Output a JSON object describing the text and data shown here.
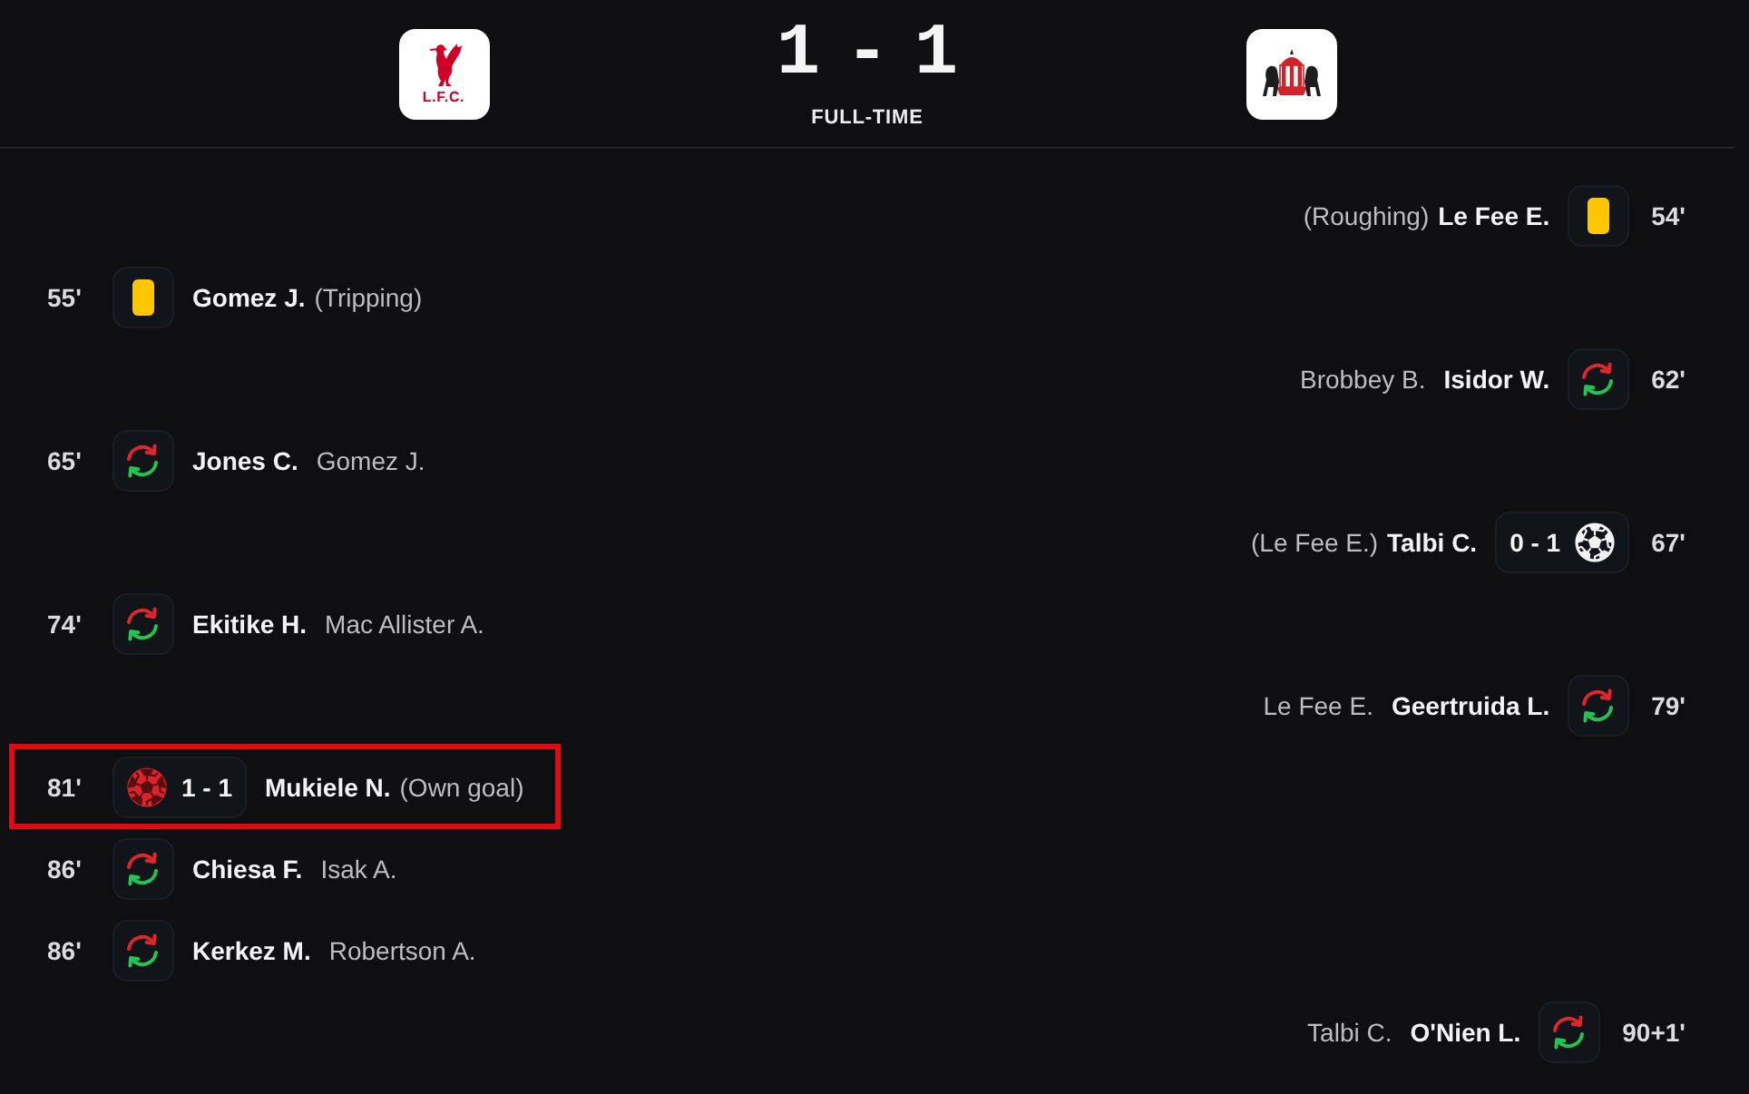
{
  "header": {
    "home_crest_text": "L.F.C.",
    "score": "1 - 1",
    "status": "FULL-TIME"
  },
  "events": [
    {
      "away": true,
      "minute": "54'",
      "kind": "yellow_card",
      "player": "Le Fee E.",
      "detail": "(Roughing)",
      "highlighted": false
    },
    {
      "away": false,
      "minute": "55'",
      "kind": "yellow_card",
      "player": "Gomez J.",
      "detail": "(Tripping)",
      "highlighted": false
    },
    {
      "away": true,
      "minute": "62'",
      "kind": "substitution",
      "player": "Isidor W.",
      "detail": "Brobbey B.",
      "highlighted": false
    },
    {
      "away": false,
      "minute": "65'",
      "kind": "substitution",
      "player": "Jones C.",
      "detail": "Gomez J.",
      "highlighted": false
    },
    {
      "away": true,
      "minute": "67'",
      "kind": "goal",
      "score": "0 - 1",
      "player": "Talbi C.",
      "detail": "(Le Fee E.)",
      "highlighted": false
    },
    {
      "away": false,
      "minute": "74'",
      "kind": "substitution",
      "player": "Ekitike H.",
      "detail": "Mac Allister A.",
      "highlighted": false
    },
    {
      "away": true,
      "minute": "79'",
      "kind": "substitution",
      "player": "Geertruida L.",
      "detail": "Le Fee E.",
      "highlighted": false
    },
    {
      "away": false,
      "minute": "81'",
      "kind": "own_goal",
      "score": "1 - 1",
      "player": "Mukiele N.",
      "detail": "(Own goal)",
      "highlighted": true
    },
    {
      "away": false,
      "minute": "86'",
      "kind": "substitution",
      "player": "Chiesa F.",
      "detail": "Isak A.",
      "highlighted": false
    },
    {
      "away": false,
      "minute": "86'",
      "kind": "substitution",
      "player": "Kerkez M.",
      "detail": "Robertson A.",
      "highlighted": false
    },
    {
      "away": true,
      "minute": "90+1'",
      "kind": "substitution",
      "player": "O'Nien L.",
      "detail": "Talbi C.",
      "highlighted": false
    }
  ]
}
